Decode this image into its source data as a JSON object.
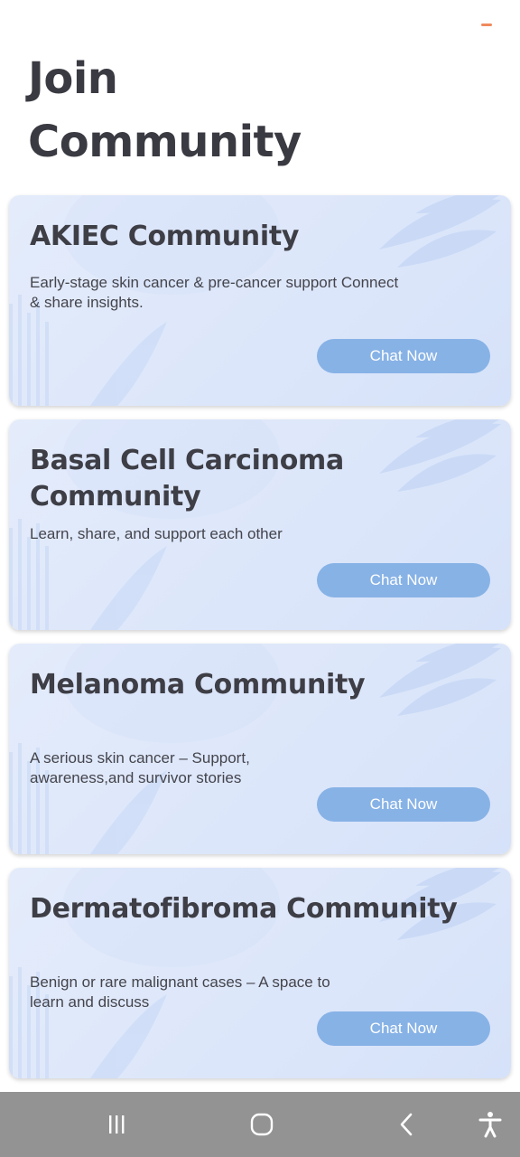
{
  "page": {
    "title_line1": "Join",
    "title_line2": "Community"
  },
  "colors": {
    "card_background": "#dde7fa",
    "button": "#87b2e6",
    "title_text": "#3a3a42",
    "navbar": "#939393",
    "top_indicator": "#f08a5d"
  },
  "communities": [
    {
      "title": "AKIEC Community",
      "description": "Early-stage skin cancer & pre-cancer support Connect & share insights.",
      "button_label": "Chat Now"
    },
    {
      "title": "Basal Cell Carcinoma Community",
      "description": "Learn, share, and support each other",
      "button_label": "Chat Now"
    },
    {
      "title": "Melanoma Community",
      "description": "A serious skin cancer – Support, awareness,and survivor stories",
      "button_label": "Chat Now"
    },
    {
      "title": "Dermatofibroma Community",
      "description": "Benign or rare malignant cases – A space to learn and discuss",
      "button_label": "Chat Now"
    }
  ],
  "navbar": {
    "icons": [
      "recent-apps-icon",
      "home-icon",
      "back-icon",
      "accessibility-icon"
    ]
  }
}
